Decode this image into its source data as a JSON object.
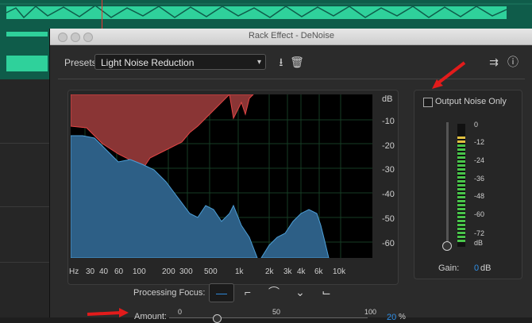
{
  "dialog": {
    "title": "Rack Effect - DeNoise"
  },
  "presets": {
    "label": "Presets:",
    "selected": "Light Noise Reduction",
    "save_icon": "download-icon",
    "delete_icon": "trash-icon",
    "routing_icon": "routing-icon",
    "info_icon": "info-icon"
  },
  "graph": {
    "y_labels": [
      "dB",
      "-10",
      "-20",
      "-30",
      "-40",
      "-50",
      "-60"
    ],
    "x_labels": [
      "Hz",
      "30",
      "40",
      "60",
      "100",
      "200",
      "300",
      "500",
      "1k",
      "2k",
      "3k",
      "4k",
      "6k",
      "10k"
    ],
    "colors": {
      "noise": "#8a3535",
      "signal": "#3d7fae"
    }
  },
  "output": {
    "checkbox_label": "Output Noise Only",
    "checked": false,
    "meter_labels": [
      "0",
      "-12",
      "-24",
      "-36",
      "-48",
      "-60",
      "-72",
      "dB"
    ],
    "gain_label": "Gain:",
    "gain_value": "0",
    "gain_unit": "dB"
  },
  "processing": {
    "label": "Processing Focus:",
    "buttons": [
      "focus-all-icon",
      "focus-low-icon",
      "focus-mid-icon",
      "focus-notch-icon",
      "focus-high-icon"
    ]
  },
  "amount": {
    "label": "Amount:",
    "ticks": [
      "0",
      "50",
      "100"
    ],
    "value": "20",
    "unit": "%"
  }
}
